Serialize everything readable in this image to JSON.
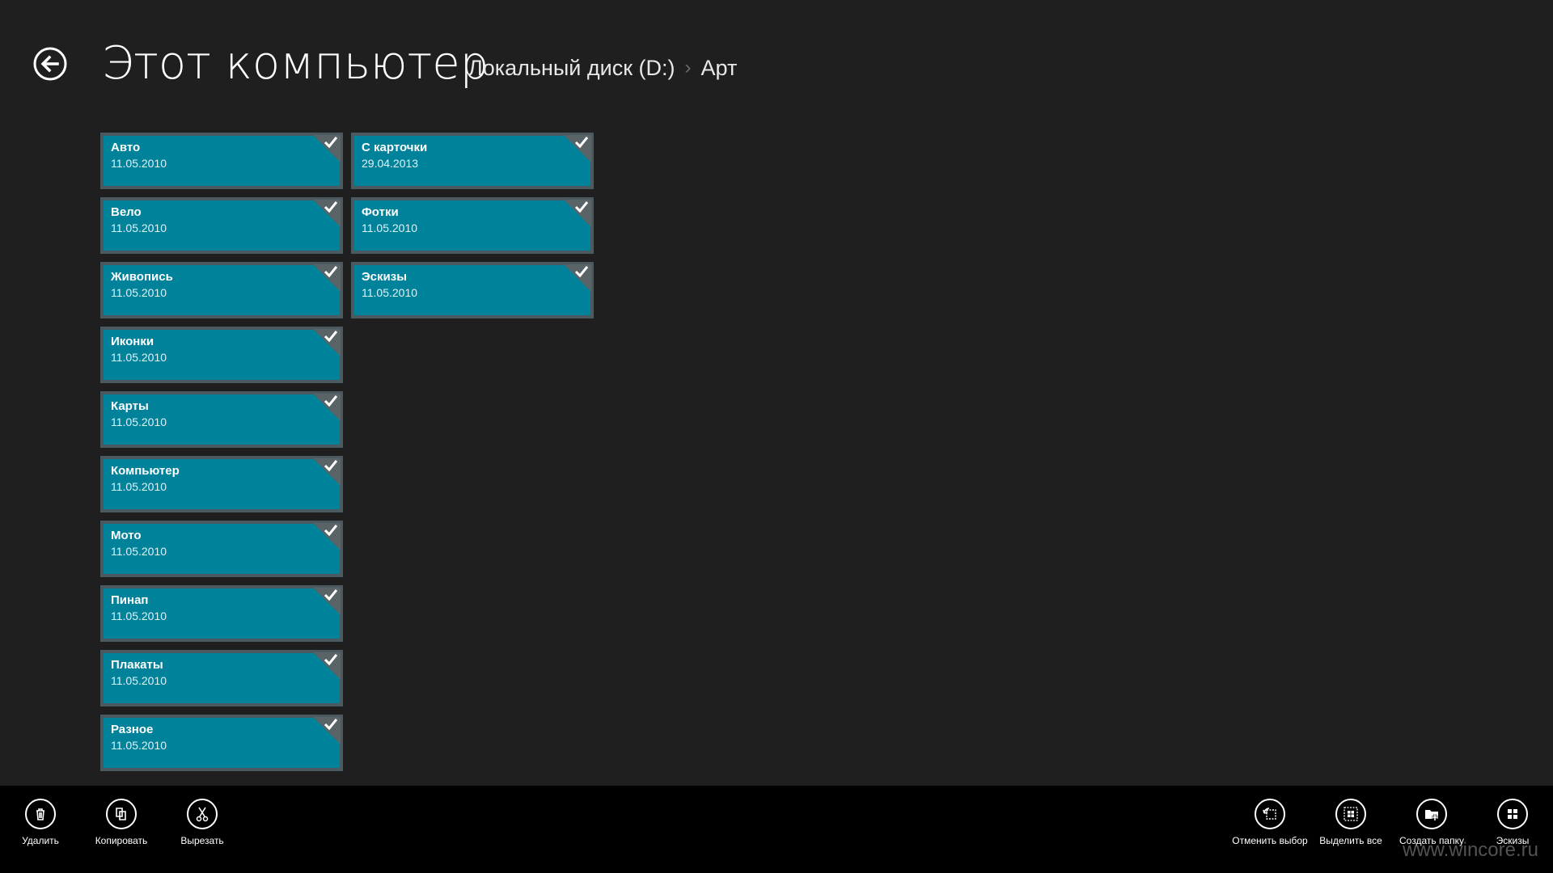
{
  "header": {
    "title": "Этот компьютер",
    "breadcrumb": [
      "Локальный диск (D:)",
      "Арт"
    ],
    "separator": "›"
  },
  "colors": {
    "background": "#1f1f1f",
    "tile": "#00829b",
    "tile_border": "#4a5a60",
    "appbar": "#000000"
  },
  "folders": [
    {
      "name": "Авто",
      "date": "11.05.2010",
      "selected": true
    },
    {
      "name": "Вело",
      "date": "11.05.2010",
      "selected": true
    },
    {
      "name": "Живопись",
      "date": "11.05.2010",
      "selected": true
    },
    {
      "name": "Иконки",
      "date": "11.05.2010",
      "selected": true
    },
    {
      "name": "Карты",
      "date": "11.05.2010",
      "selected": true
    },
    {
      "name": "Компьютер",
      "date": "11.05.2010",
      "selected": true
    },
    {
      "name": "Мото",
      "date": "11.05.2010",
      "selected": true
    },
    {
      "name": "Пинап",
      "date": "11.05.2010",
      "selected": true
    },
    {
      "name": "Плакаты",
      "date": "11.05.2010",
      "selected": true
    },
    {
      "name": "Разное",
      "date": "11.05.2010",
      "selected": true
    },
    {
      "name": "С карточки",
      "date": "29.04.2013",
      "selected": true
    },
    {
      "name": "Фотки",
      "date": "11.05.2010",
      "selected": true
    },
    {
      "name": "Эскизы",
      "date": "11.05.2010",
      "selected": true
    }
  ],
  "appbar": {
    "left": [
      {
        "label": "Удалить",
        "icon": "trash-icon"
      },
      {
        "label": "Копировать",
        "icon": "copy-icon"
      },
      {
        "label": "Вырезать",
        "icon": "scissors-icon"
      }
    ],
    "right": [
      {
        "label": "Отменить выбор",
        "icon": "undo-selection-icon"
      },
      {
        "label": "Выделить все",
        "icon": "select-all-icon"
      },
      {
        "label": "Создать папку",
        "icon": "new-folder-icon"
      },
      {
        "label": "Эскизы",
        "icon": "thumbnails-icon"
      }
    ]
  },
  "watermark": "www.wincore.ru"
}
